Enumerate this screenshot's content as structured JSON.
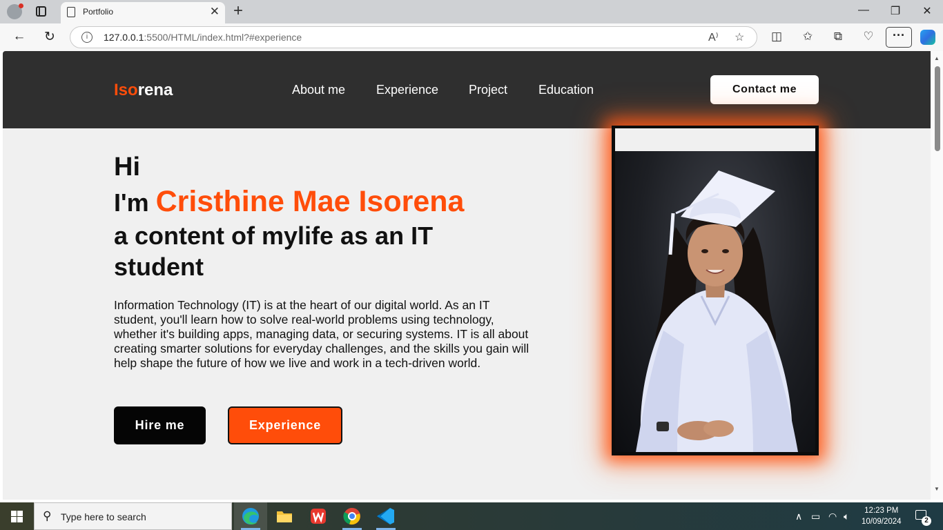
{
  "browser": {
    "tab_title": "Portfolio",
    "url_host": "127.0.0.1",
    "url_rest": ":5500/HTML/index.html?#experience"
  },
  "site": {
    "logo_accent": "Iso",
    "logo_rest": "rena",
    "nav": [
      "About me",
      "Experience",
      "Project",
      "Education"
    ],
    "contact_label": "Contact me",
    "accent_color": "#ff4d0a"
  },
  "hero": {
    "hi": "Hi",
    "im_prefix": "I'm ",
    "name": "Cristhine Mae Isorena",
    "tagline": "a content of mylife as an IT student",
    "description": "Information Technology (IT) is at the heart of our digital world. As an IT student, you'll learn how to solve real-world problems using technology, whether it's building apps, managing data, or securing systems. IT is all about creating smarter solutions for everyday challenges, and the skills you gain will help shape the future of how we live and work in a tech-driven world.",
    "hire_label": "Hire me",
    "experience_label": "Experience"
  },
  "taskbar": {
    "search_placeholder": "Type here to search",
    "time": "12:23 PM",
    "date": "10/09/2024",
    "notification_count": "2"
  }
}
